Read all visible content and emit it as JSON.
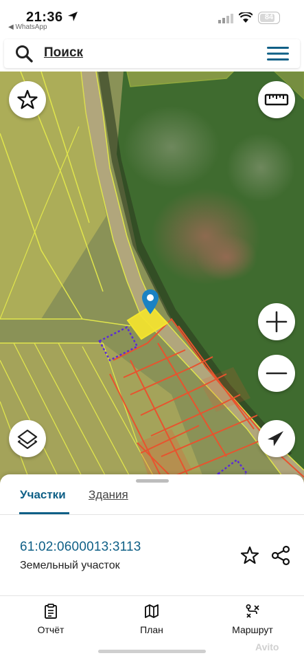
{
  "status_bar": {
    "time": "21:36",
    "back_app": "◀ WhatsApp",
    "battery": "84",
    "battery_fraction": 0.84
  },
  "header": {
    "search_label": "Поиск",
    "icons": [
      "search-icon",
      "menu-icon"
    ]
  },
  "map": {
    "buttons": [
      "star-icon",
      "ruler-icon",
      "zoom-in-icon",
      "zoom-out-icon",
      "layers-icon",
      "navigation-arrow-icon"
    ],
    "pin": "location-pin-icon",
    "colors": {
      "selected_parcel": "#f2e230",
      "parcel_outline": "#e1e64c",
      "neighbor_parcels": "#e8532e",
      "dotted_parcels": "#5a2ad8",
      "pin": "#1a82c3"
    }
  },
  "panel": {
    "tabs": [
      {
        "label": "Участки",
        "active": true
      },
      {
        "label": "Здания",
        "active": false
      }
    ],
    "parcel": {
      "cadastral_number": "61:02:0600013:3113",
      "type": "Земельный участок"
    },
    "actions": [
      {
        "label": "Отчёт",
        "icon": "report-icon"
      },
      {
        "label": "План",
        "icon": "map-plan-icon"
      },
      {
        "label": "Маршрут",
        "icon": "route-icon"
      }
    ],
    "watermark": "Avito"
  },
  "colors": {
    "accent": "#0e5f86"
  }
}
